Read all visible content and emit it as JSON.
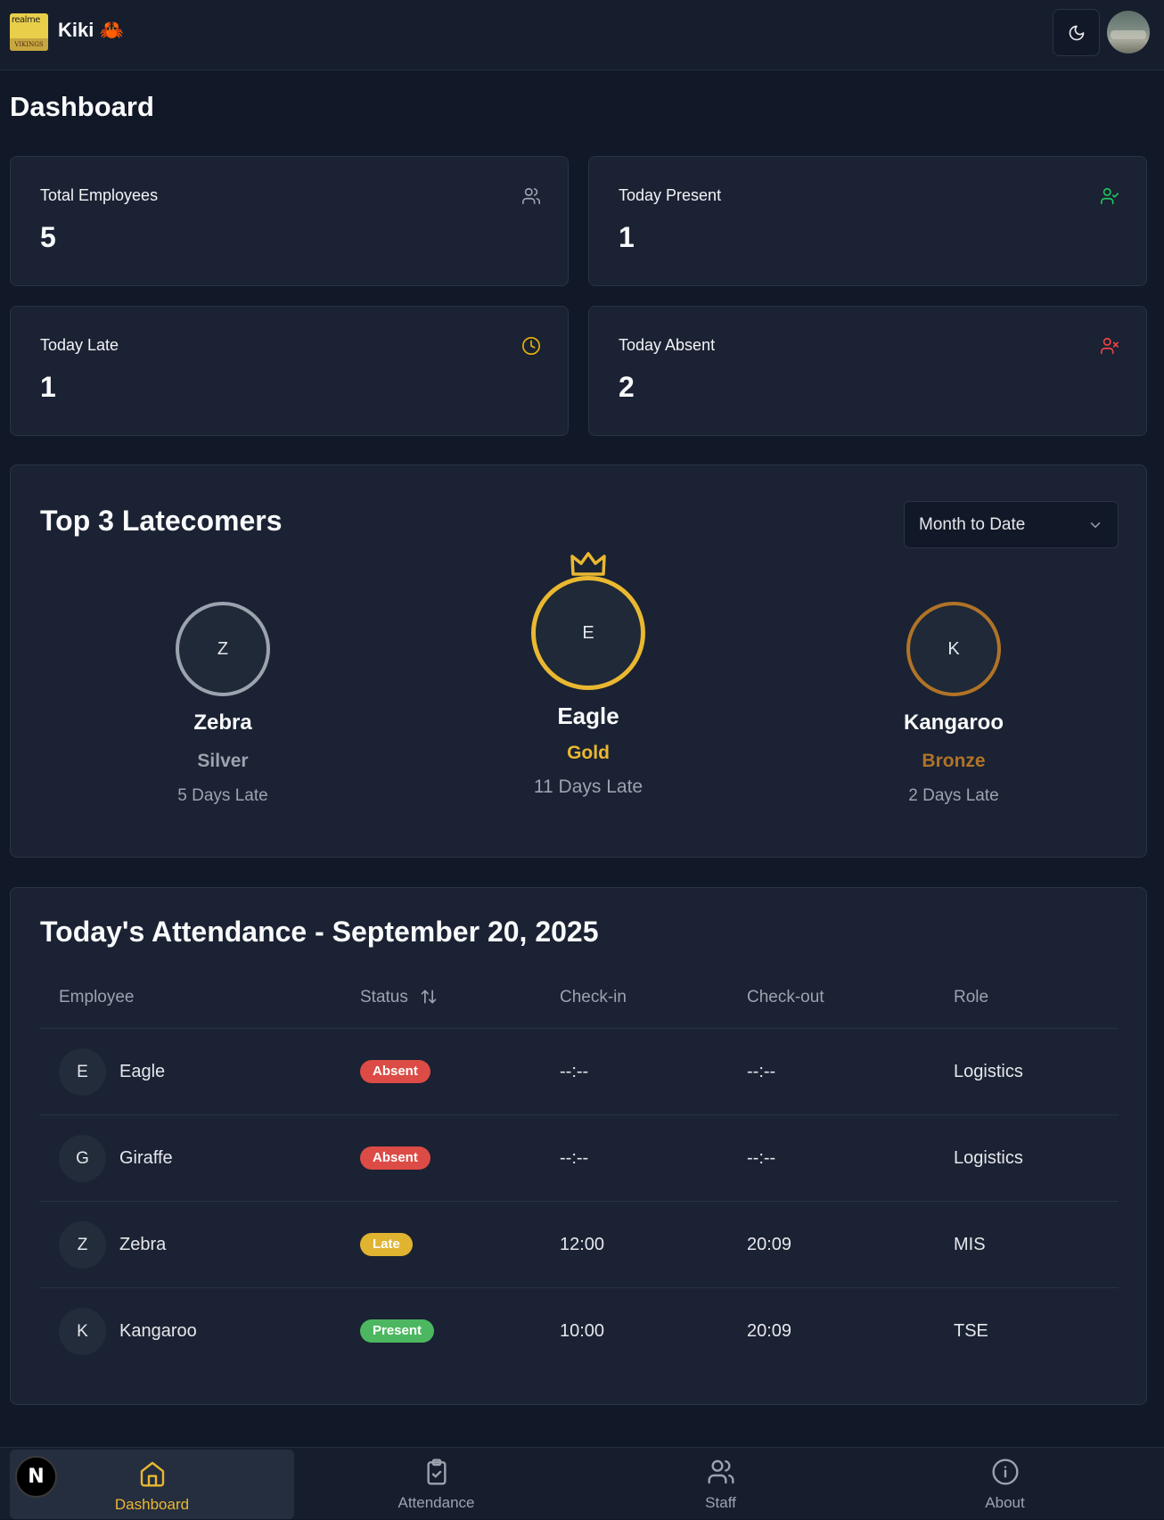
{
  "header": {
    "brand": "Kiki 🦀",
    "logo_text_top": "realme",
    "logo_text_bottom": "VIKINGS",
    "theme_icon": "moon-icon"
  },
  "page": {
    "title": "Dashboard"
  },
  "stats": [
    {
      "label": "Total Employees",
      "value": "5",
      "icon": "users-icon",
      "color": "#9ca3af"
    },
    {
      "label": "Today Present",
      "value": "1",
      "icon": "user-check-icon",
      "color": "#22c55e"
    },
    {
      "label": "Today Late",
      "value": "1",
      "icon": "clock-icon",
      "color": "#eab308"
    },
    {
      "label": "Today Absent",
      "value": "2",
      "icon": "user-x-icon",
      "color": "#ef4444"
    }
  ],
  "latecomers": {
    "title": "Top 3 Latecomers",
    "period": "Month to Date",
    "podium": [
      {
        "initial": "Z",
        "name": "Zebra",
        "rank": "Silver",
        "days": "5 Days Late",
        "color": "#9ca3af"
      },
      {
        "initial": "E",
        "name": "Eagle",
        "rank": "Gold",
        "days": "11 Days Late",
        "color": "#eab830"
      },
      {
        "initial": "K",
        "name": "Kangaroo",
        "rank": "Bronze",
        "days": "2 Days Late",
        "color": "#b07327"
      }
    ]
  },
  "attendance": {
    "title": "Today's Attendance - September 20, 2025",
    "columns": [
      "Employee",
      "Status",
      "Check-in",
      "Check-out",
      "Role"
    ],
    "rows": [
      {
        "initial": "E",
        "name": "Eagle",
        "status": "Absent",
        "checkin": "--:--",
        "checkout": "--:--",
        "role": "Logistics"
      },
      {
        "initial": "G",
        "name": "Giraffe",
        "status": "Absent",
        "checkin": "--:--",
        "checkout": "--:--",
        "role": "Logistics"
      },
      {
        "initial": "Z",
        "name": "Zebra",
        "status": "Late",
        "checkin": "12:00",
        "checkout": "20:09",
        "role": "MIS"
      },
      {
        "initial": "K",
        "name": "Kangaroo",
        "status": "Present",
        "checkin": "10:00",
        "checkout": "20:09",
        "role": "TSE"
      }
    ],
    "status_colors": {
      "Absent": "#dc4b45",
      "Late": "#e0b330",
      "Present": "#4cb760"
    }
  },
  "nav": {
    "badge": "N",
    "items": [
      {
        "label": "Dashboard",
        "icon": "home-icon"
      },
      {
        "label": "Attendance",
        "icon": "clipboard-check-icon"
      },
      {
        "label": "Staff",
        "icon": "users-icon"
      },
      {
        "label": "About",
        "icon": "info-icon"
      }
    ]
  }
}
